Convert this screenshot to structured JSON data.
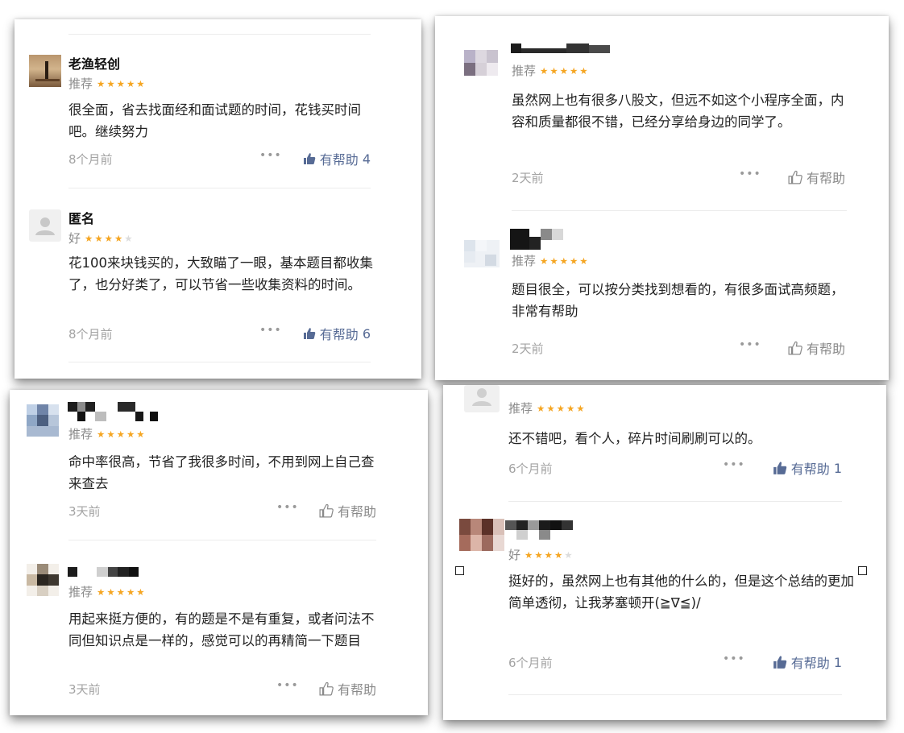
{
  "panels": [
    {
      "reviews": [
        {
          "name": "老渔轻创",
          "rating_label": "推荐",
          "stars": 5,
          "text": "很全面，省去找面经和面试题的时间，花钱买时间吧。继续努力",
          "time": "8个月前",
          "helpful_label": "有帮助",
          "helpful_count": "4",
          "liked": true
        },
        {
          "name": "匿名",
          "rating_label": "好",
          "stars": 4,
          "text": "花100来块钱买的，大致瞄了一眼，基本题目都收集了，也分好类了，可以节省一些收集资料的时间。",
          "time": "8个月前",
          "helpful_label": "有帮助",
          "helpful_count": "6",
          "liked": true
        }
      ]
    },
    {
      "reviews": [
        {
          "name": "",
          "rating_label": "推荐",
          "stars": 5,
          "text": "虽然网上也有很多八股文，但远不如这个小程序全面，内容和质量都很不错，已经分享给身边的同学了。",
          "time": "2天前",
          "helpful_label": "有帮助",
          "helpful_count": "",
          "liked": false
        },
        {
          "name": "",
          "rating_label": "推荐",
          "stars": 5,
          "text": "题目很全，可以按分类找到想看的，有很多面试高频题，非常有帮助",
          "time": "2天前",
          "helpful_label": "有帮助",
          "helpful_count": "",
          "liked": false
        }
      ]
    },
    {
      "reviews": [
        {
          "name": "",
          "rating_label": "推荐",
          "stars": 5,
          "text": "命中率很高，节省了我很多时间，不用到网上自己查来查去",
          "time": "3天前",
          "helpful_label": "有帮助",
          "helpful_count": "",
          "liked": false
        },
        {
          "name": "",
          "rating_label": "推荐",
          "stars": 5,
          "text": "用起来挺方便的，有的题是不是有重复，或者问法不同但知识点是一样的，感觉可以的再精简一下题目",
          "time": "3天前",
          "helpful_label": "有帮助",
          "helpful_count": "",
          "liked": false
        }
      ]
    },
    {
      "reviews": [
        {
          "name": "",
          "rating_label": "推荐",
          "stars": 5,
          "text": "还不错吧，看个人，碎片时间刷刷可以的。",
          "time": "6个月前",
          "helpful_label": "有帮助",
          "helpful_count": "1",
          "liked": true
        },
        {
          "name": "",
          "rating_label": "好",
          "stars": 4,
          "text": "挺好的，虽然网上也有其他的什么的，但是这个总结的更加简单透彻，让我茅塞顿开(≧∇≦)/",
          "time": "6个月前",
          "helpful_label": "有帮助",
          "helpful_count": "1",
          "liked": true
        }
      ]
    }
  ],
  "colors": {
    "star_on": "#f5a623",
    "star_off": "#dcdcdc",
    "helpful_active": "#576b95",
    "meta_gray": "#a3a3a3"
  }
}
